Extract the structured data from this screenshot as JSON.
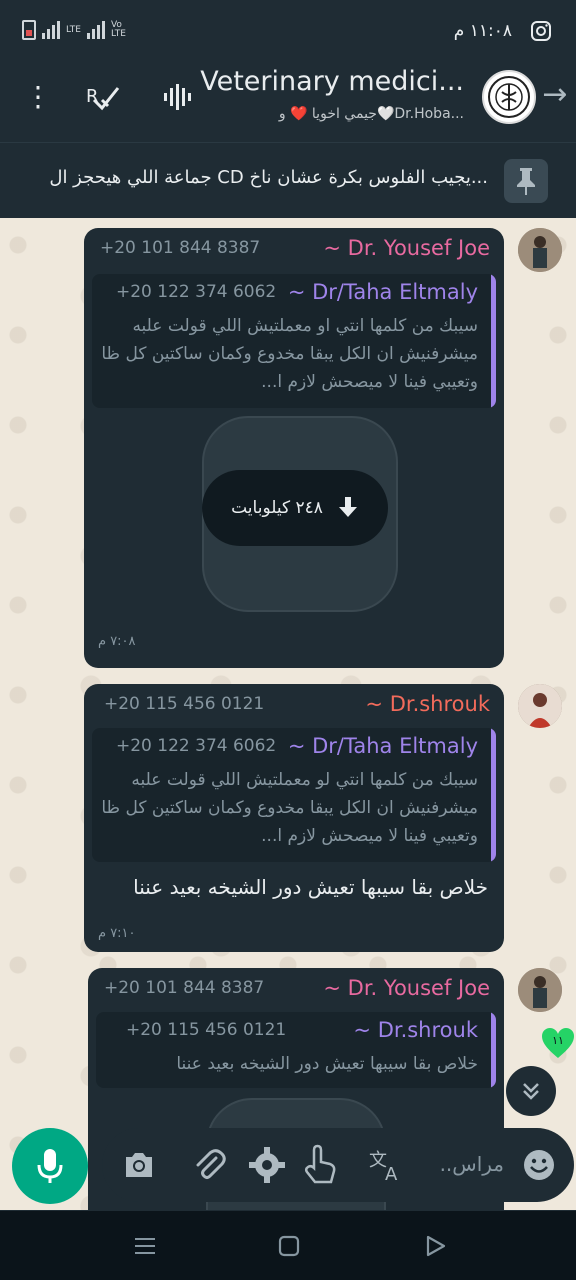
{
  "status_bar": {
    "time": "١١:٠٨ م",
    "network": "LTE",
    "volte": "Vo LTE"
  },
  "header": {
    "title": "Veterinary medici...",
    "subtitle": "جيمي اخويا ❤️ و🤍Dr.Hoba..."
  },
  "pinned": {
    "text": "جماعة اللي هيحجز ال CD يجيب الفلوس بكرة عشان ناخ..."
  },
  "messages": [
    {
      "sender_name": "~ Dr. Yousef Joe",
      "sender_phone": "+20 101 844 8387",
      "sender_color": "#e86aa0",
      "quote": {
        "name": "~ Dr/Taha Eltmaly",
        "phone": "+20 122 374 6062",
        "text": "سيبك من كلمها انتي او معملتيش اللي قولت علبه ميشرفنيش ان الكل يبقا مخدوع وكمان ساكتين كل ظا وتعيبي فينا لا ميصحش لازم ا..."
      },
      "attachment_size": "٢٤٨ كيلوبايت",
      "time": "٧:٠٨ م"
    },
    {
      "sender_name": "~ Dr.shrouk",
      "sender_phone": "+20 115 456 0121",
      "sender_color": "#f26b5b",
      "quote": {
        "name": "~ Dr/Taha Eltmaly",
        "phone": "+20 122 374 6062",
        "text": "سيبك من كلمها انتي لو معملتيش اللي قولت علبه ميشرفنيش ان الكل يبقا مخدوع وكمان ساكتين كل ظا وتعيبي فينا لا ميصحش لازم ا..."
      },
      "text": "خلاص بقا  سيبها تعيش دور الشيخه بعيد عننا",
      "time": "٧:١٠ م"
    },
    {
      "sender_name": "~ Dr. Yousef Joe",
      "sender_phone": "+20 101 844 8387",
      "sender_color": "#e86aa0",
      "quote": {
        "name": "~ Dr.shrouk",
        "phone": "+20 115 456 0121",
        "text": "خلاص بقا  سيبها تعيش دور الشيخه بعيد عننا"
      }
    }
  ],
  "unread_count": "١١",
  "composer": {
    "placeholder": "مراس.."
  }
}
